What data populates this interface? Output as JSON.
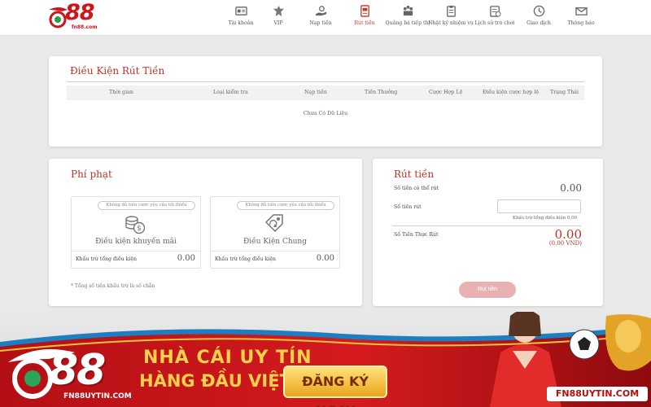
{
  "brand": {
    "logo_text": "88",
    "logo_domain": "fn88.com",
    "brand_color": "#d0141b"
  },
  "nav": {
    "items": [
      {
        "label": "Tài khoản",
        "icon": "account-card-icon"
      },
      {
        "label": "VIP",
        "icon": "vip-badge-icon"
      },
      {
        "label": "Nạp tiền",
        "icon": "deposit-hand-icon"
      },
      {
        "label": "Rút tiền",
        "icon": "withdraw-icon",
        "active": true
      },
      {
        "label": "Quảng bá tiếp thị",
        "icon": "marketing-people-icon"
      },
      {
        "label": "Nhật ký nhiệm vụ",
        "icon": "task-clipboard-icon"
      },
      {
        "label": "Lịch sử trò chơi",
        "icon": "game-history-icon"
      },
      {
        "label": "Giao dịch",
        "icon": "transaction-clock-icon"
      },
      {
        "label": "Thông báo",
        "icon": "mail-envelope-icon"
      }
    ]
  },
  "conditions": {
    "title": "Điều Kiện Rút Tiền",
    "columns": [
      "Thời gian",
      "Loại kiểm tra",
      "Nạp tiền",
      "Tiền Thưởng",
      "Cược Hợp Lệ",
      "Điều kiện cược hợp lệ",
      "Trạng Thái"
    ],
    "empty_text": "Chưa Có Dữ Liệu"
  },
  "penalty": {
    "title": "Phí phạt",
    "boxes": [
      {
        "badge": "Không đủ tiền cược yêu cầu tối thiểu",
        "name": "Điều kiện khuyến mãi",
        "deduct_label": "Khấu trừ tổng điều kiện",
        "value": "0.00",
        "icon": "money-coins-icon"
      },
      {
        "badge": "Không đủ tiền cược yêu cầu tối thiểu",
        "name": "Điều Kiện Chung",
        "deduct_label": "Khấu trừ tổng điều kiện",
        "value": "0.00",
        "icon": "tag-refresh-icon"
      }
    ],
    "note": "* Tổng số tiền khấu trừ là số chẵn"
  },
  "withdraw": {
    "title": "Rút tiền",
    "available_label": "Số tiền có thể rút",
    "available_value": "0.00",
    "amount_label": "Số tiền rút",
    "amount_value": "",
    "hint": "Khấu trừ tổng điều kiện 0.00",
    "actual_label": "Số Tiền Thực Rút",
    "actual_value": "0.00",
    "actual_vnd": "(0.00 VND)",
    "button_label": "Rút tiền"
  },
  "banner": {
    "logo_text": "88",
    "logo_domain": "FN88UYTIN.COM",
    "line1": "NHÀ CÁI UY TÍN",
    "line2": "HÀNG ĐẦU VIỆT NAM",
    "cta": "ĐĂNG KÝ NGAY",
    "site": "FN88UYTIN.COM"
  }
}
